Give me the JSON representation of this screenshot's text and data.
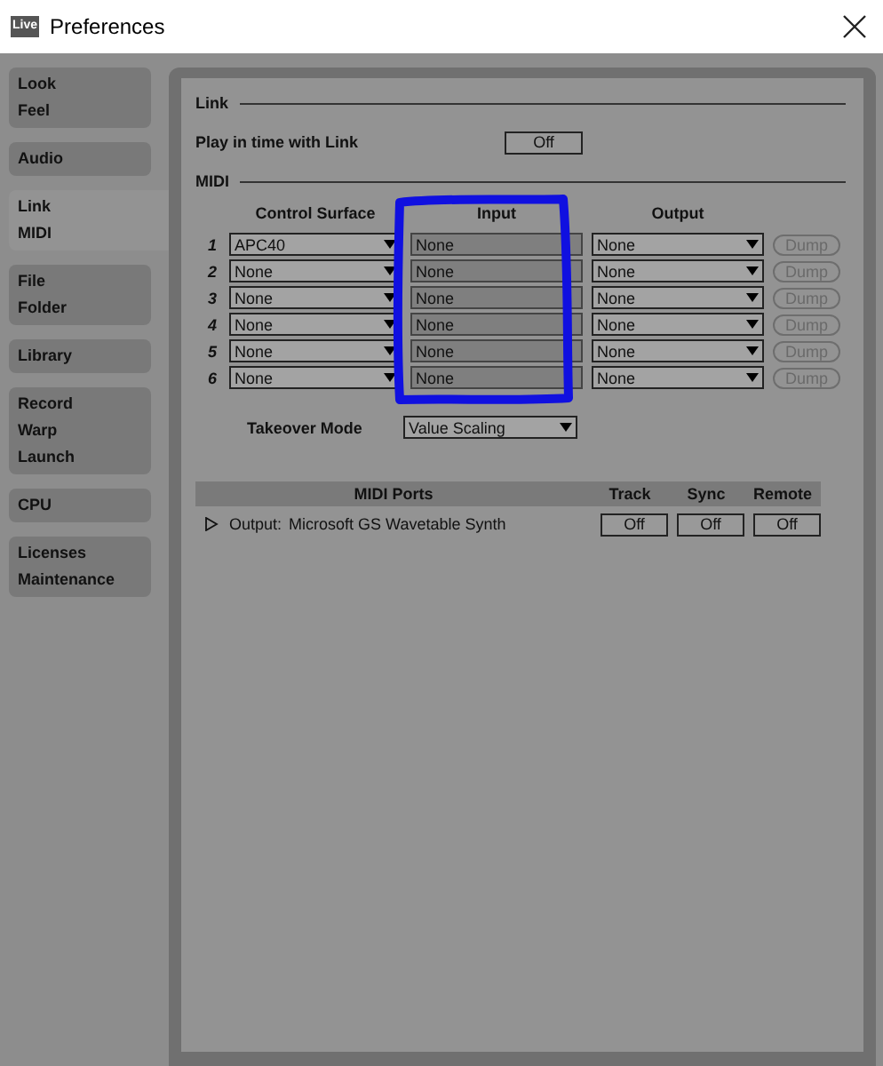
{
  "window": {
    "title": "Preferences",
    "app_icon": "Live"
  },
  "sidebar": {
    "tabs": [
      {
        "labels": [
          "Look",
          "Feel"
        ],
        "selected": false
      },
      {
        "labels": [
          "Audio"
        ],
        "selected": false
      },
      {
        "labels": [
          "Link",
          "MIDI"
        ],
        "selected": true
      },
      {
        "labels": [
          "File",
          "Folder"
        ],
        "selected": false
      },
      {
        "labels": [
          "Library"
        ],
        "selected": false
      },
      {
        "labels": [
          "Record",
          "Warp",
          "Launch"
        ],
        "selected": false
      },
      {
        "labels": [
          "CPU"
        ],
        "selected": false
      },
      {
        "labels": [
          "Licenses",
          "Maintenance"
        ],
        "selected": false
      }
    ]
  },
  "link": {
    "heading": "Link",
    "label": "Play in time with Link",
    "button": "Off"
  },
  "midi": {
    "heading": "MIDI",
    "columns": [
      "Control Surface",
      "Input",
      "Output"
    ],
    "rows": [
      {
        "number": "1",
        "surface": "APC40",
        "input": "None",
        "output": "None",
        "dump": "Dump",
        "dump_disabled": true
      },
      {
        "number": "2",
        "surface": "None",
        "input": "None",
        "output": "None",
        "dump": "Dump",
        "dump_disabled": true
      },
      {
        "number": "3",
        "surface": "None",
        "input": "None",
        "output": "None",
        "dump": "Dump",
        "dump_disabled": true
      },
      {
        "number": "4",
        "surface": "None",
        "input": "None",
        "output": "None",
        "dump": "Dump",
        "dump_disabled": true
      },
      {
        "number": "5",
        "surface": "None",
        "input": "None",
        "output": "None",
        "dump": "Dump",
        "dump_disabled": true
      },
      {
        "number": "6",
        "surface": "None",
        "input": "None",
        "output": "None",
        "dump": "Dump",
        "dump_disabled": true
      }
    ],
    "takeover_label": "Takeover Mode",
    "takeover_value": "Value Scaling"
  },
  "ports": {
    "columns": [
      "MIDI Ports",
      "Track",
      "Sync",
      "Remote"
    ],
    "rows": [
      {
        "expanded": false,
        "label": "Output:",
        "name": "Microsoft GS Wavetable Synth",
        "track": "Off",
        "sync": "Off",
        "remote": "Off"
      }
    ]
  }
}
